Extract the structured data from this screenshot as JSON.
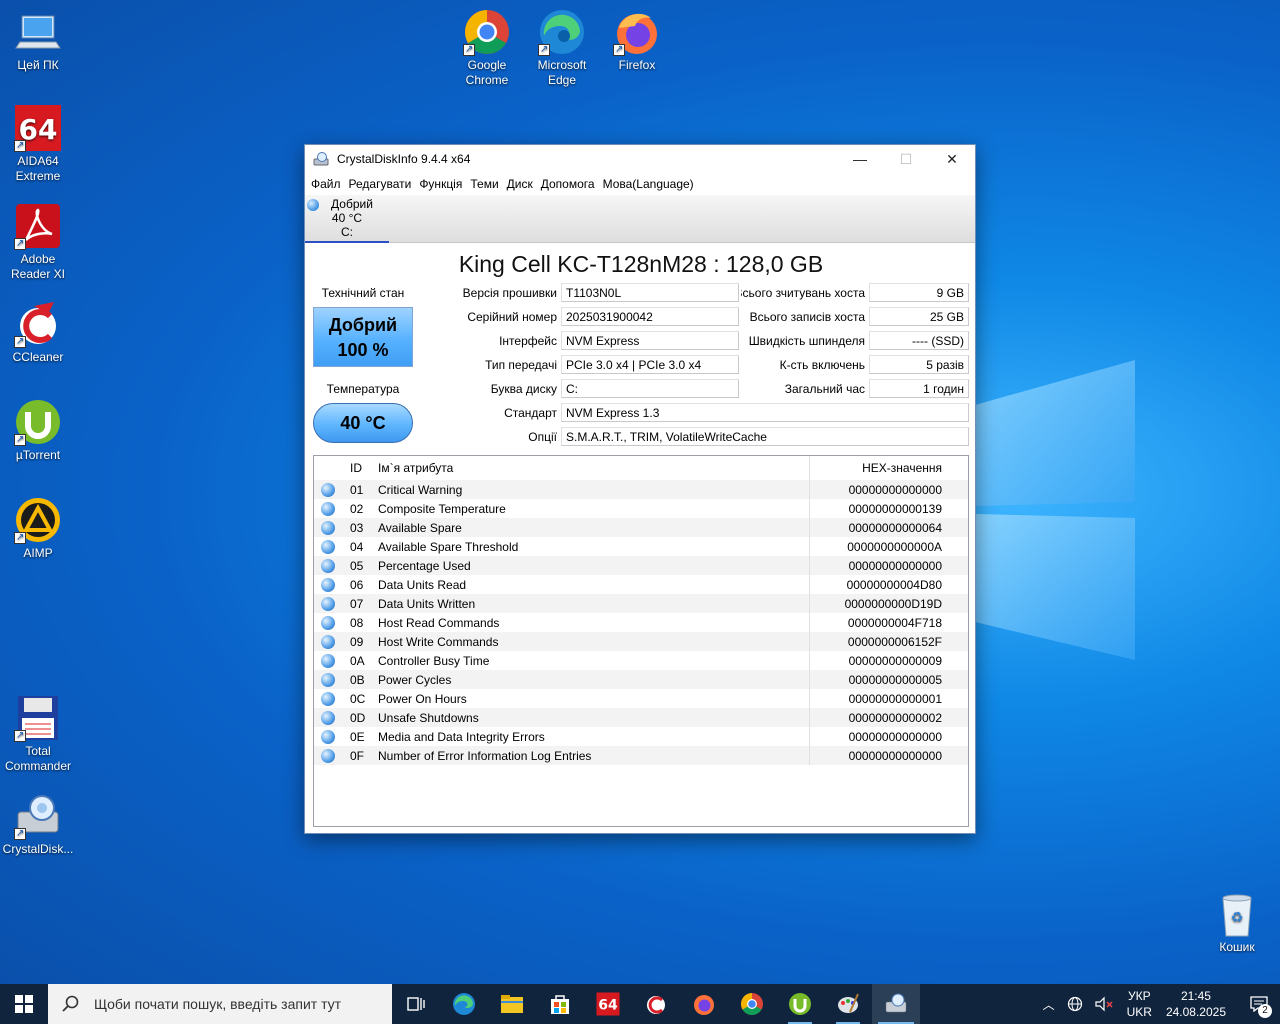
{
  "desktop": {
    "icons_left": [
      {
        "label": "Цей ПК"
      },
      {
        "label": "AIDA64 Extreme"
      },
      {
        "label": "Adobe Reader XI"
      },
      {
        "label": "CCleaner"
      },
      {
        "label": "µTorrent"
      },
      {
        "label": "AIMP"
      },
      {
        "label": "Total Commander"
      },
      {
        "label": "CrystalDisk..."
      }
    ],
    "icons_top": [
      {
        "label": "Google Chrome"
      },
      {
        "label": "Microsoft Edge"
      },
      {
        "label": "Firefox"
      }
    ],
    "recycle": {
      "label": "Кошик"
    }
  },
  "window": {
    "title": "CrystalDiskInfo 9.4.4 x64",
    "controls": {
      "minimize": "—",
      "maximize": "☐",
      "close": "✕"
    },
    "menu": [
      "Файл",
      "Редагувати",
      "Функція",
      "Теми",
      "Диск",
      "Допомога",
      "Мова(Language)"
    ],
    "drive_tab": {
      "status": "Добрий",
      "temp": "40 °C",
      "letter": "C:"
    },
    "model": "King Cell KC-T128nM28 : 128,0 GB",
    "health": {
      "label": "Технічний стан",
      "status": "Добрий",
      "percent": "100 %"
    },
    "temperature": {
      "label": "Температура",
      "value": "40 °C"
    },
    "info": {
      "firmware": {
        "label": "Версія прошивки",
        "value": "T1103N0L"
      },
      "serial": {
        "label": "Серійний номер",
        "value": "2025031900042"
      },
      "interface": {
        "label": "Інтерфейс",
        "value": "NVM Express"
      },
      "transfer": {
        "label": "Тип передачі",
        "value": "PCIe 3.0 x4 | PCIe 3.0 x4"
      },
      "drive_letter": {
        "label": "Буква диску",
        "value": "C:"
      },
      "standard": {
        "label": "Стандарт",
        "value": "NVM Express 1.3"
      },
      "features": {
        "label": "Опції",
        "value": "S.M.A.R.T., TRIM, VolatileWriteCache"
      },
      "host_reads": {
        "label": "Всього зчитувань хоста",
        "value": "9 GB"
      },
      "host_writes": {
        "label": "Всього записів хоста",
        "value": "25 GB"
      },
      "rotation": {
        "label": "Швидкість шпинделя",
        "value": "---- (SSD)"
      },
      "power_count": {
        "label": "К-сть включень",
        "value": "5 разів"
      },
      "power_hours": {
        "label": "Загальний час",
        "value": "1 годин"
      }
    },
    "smart": {
      "headers": {
        "id": "ID",
        "name": "Ім`я атрибута",
        "hex": "HEX-значення"
      },
      "rows": [
        {
          "id": "01",
          "name": "Critical Warning",
          "hex": "00000000000000"
        },
        {
          "id": "02",
          "name": "Composite Temperature",
          "hex": "00000000000139"
        },
        {
          "id": "03",
          "name": "Available Spare",
          "hex": "00000000000064"
        },
        {
          "id": "04",
          "name": "Available Spare Threshold",
          "hex": "0000000000000A"
        },
        {
          "id": "05",
          "name": "Percentage Used",
          "hex": "00000000000000"
        },
        {
          "id": "06",
          "name": "Data Units Read",
          "hex": "00000000004D80"
        },
        {
          "id": "07",
          "name": "Data Units Written",
          "hex": "0000000000D19D"
        },
        {
          "id": "08",
          "name": "Host Read Commands",
          "hex": "0000000004F718"
        },
        {
          "id": "09",
          "name": "Host Write Commands",
          "hex": "0000000006152F"
        },
        {
          "id": "0A",
          "name": "Controller Busy Time",
          "hex": "00000000000009"
        },
        {
          "id": "0B",
          "name": "Power Cycles",
          "hex": "00000000000005"
        },
        {
          "id": "0C",
          "name": "Power On Hours",
          "hex": "00000000000001"
        },
        {
          "id": "0D",
          "name": "Unsafe Shutdowns",
          "hex": "00000000000002"
        },
        {
          "id": "0E",
          "name": "Media and Data Integrity Errors",
          "hex": "00000000000000"
        },
        {
          "id": "0F",
          "name": "Number of Error Information Log Entries",
          "hex": "00000000000000"
        }
      ]
    }
  },
  "taskbar": {
    "search_placeholder": "Щоби почати пошук, введіть запит тут",
    "lang_top": "УКР",
    "lang_bottom": "UKR",
    "time": "21:45",
    "date": "24.08.2025",
    "notifications": "2"
  }
}
